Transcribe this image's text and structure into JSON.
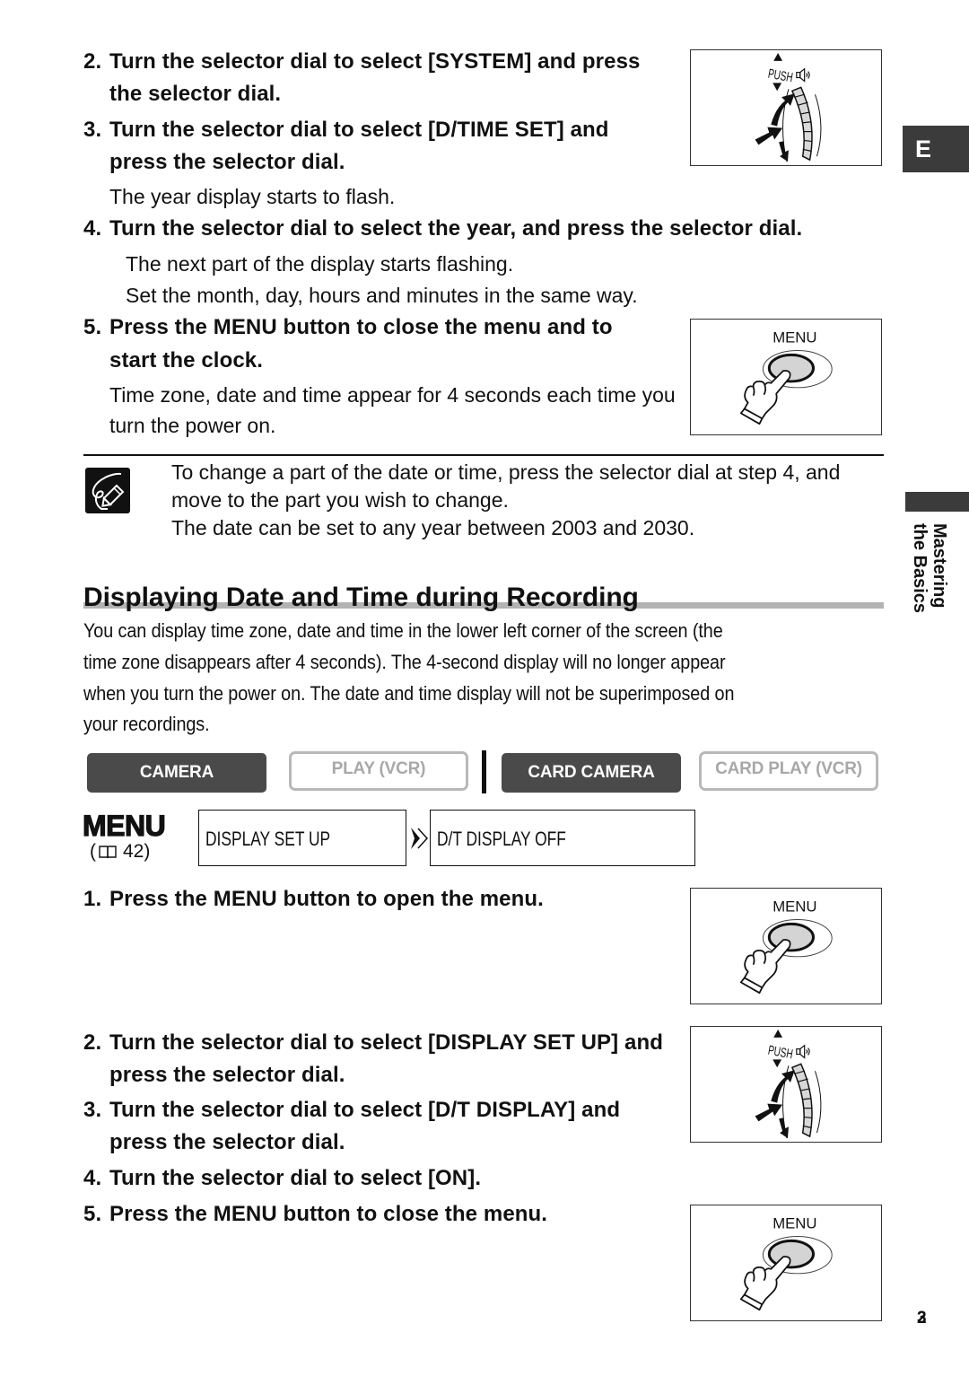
{
  "side": {
    "language_tab": "E",
    "section_tab_lines": [
      "Mastering",
      "the Basics"
    ]
  },
  "date_time_setup": {
    "steps": [
      {
        "num": "2.",
        "lines": [
          "Turn the selector dial to select [SYSTEM] and press",
          "the selector dial."
        ]
      },
      {
        "num": "3.",
        "lines": [
          "Turn the selector dial to select [D/TIME SET] and",
          "press the selector dial."
        ],
        "notes": [
          "The year display starts to flash."
        ]
      },
      {
        "num": "4.",
        "lines": [
          "Turn the selector dial to select the year, and press the selector dial."
        ],
        "notes": [
          "The next part of the display starts flashing.",
          "Set the month, day, hours and minutes in the same way."
        ]
      },
      {
        "num": "5.",
        "lines": [
          "Press the MENU button to close the menu and to",
          "start the clock."
        ],
        "notes": [
          "Time zone, date and time appear for 4 seconds each time you",
          "turn the power on."
        ]
      }
    ],
    "note": {
      "icon": "pencil-note-icon",
      "lines": [
        "To change a part of the date or time, press the selector dial at step 4, and",
        "move to the part you wish to change.",
        "The date can be set to any year between 2003 and 2030."
      ]
    }
  },
  "display_section": {
    "heading": "Displaying Date and Time during Recording",
    "paragraph_lines": [
      "You can display time zone, date and time in the lower left corner of the screen (the",
      "time zone disappears after 4 seconds). The 4-second display will no longer appear",
      "when you turn the power on. The date and time display will not be superimposed on",
      "your recordings."
    ],
    "modes": [
      {
        "label": "CAMERA",
        "active": true
      },
      {
        "label": "PLAY (VCR)",
        "active": false
      },
      {
        "label": "CARD CAMERA",
        "active": true
      },
      {
        "label": "CARD PLAY (VCR)",
        "active": false
      }
    ],
    "menu_path": {
      "logo": "MENU",
      "ref_open": "(",
      "ref_page": "42)",
      "items": [
        "DISPLAY SET UP",
        "D/T DISPLAY  OFF"
      ]
    },
    "steps": [
      {
        "num": "1.",
        "lines": [
          "Press the MENU button to open the menu."
        ]
      },
      {
        "num": "2.",
        "lines": [
          "Turn the selector dial to select [DISPLAY SET UP] and",
          "press the selector dial."
        ]
      },
      {
        "num": "3.",
        "lines": [
          "Turn the selector dial to select [D/T DISPLAY] and",
          "press the selector dial."
        ]
      },
      {
        "num": "4.",
        "lines": [
          "Turn the selector dial to select [ON]."
        ]
      },
      {
        "num": "5.",
        "lines": [
          "Press the MENU button to close the menu."
        ]
      }
    ]
  },
  "illustrations": {
    "dial_label": "PUSH",
    "menu_button_label": "MENU"
  },
  "page_number": "23",
  "colors": {
    "dark_tab": "#3b3b3b",
    "mode_active": "#4a4a4a",
    "mode_inactive_border": "#b8b8b8",
    "mode_inactive_text": "#a8a8a8",
    "heading_bar": "#b3b3b3"
  }
}
